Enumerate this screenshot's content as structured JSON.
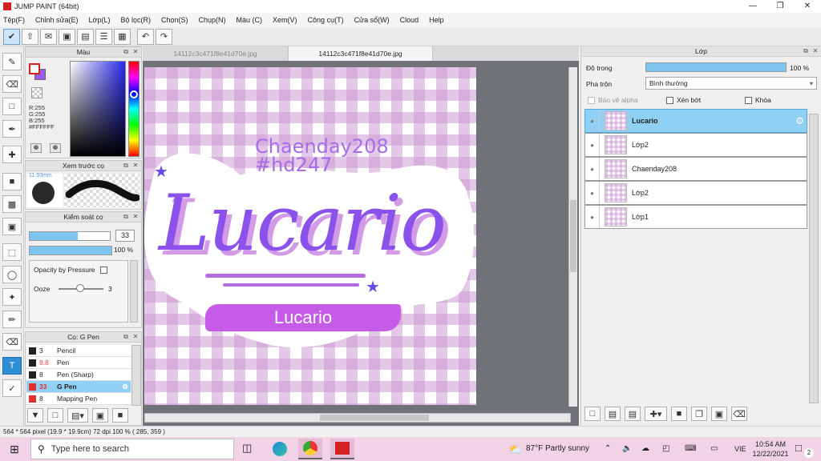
{
  "window": {
    "title": "JUMP PAINT (64bit)"
  },
  "menu": [
    "Tệp(F)",
    "Chỉnh sửa(E)",
    "Lớp(L)",
    "Bộ lọc(R)",
    "Chọn(S)",
    "Chụp(N)",
    "Màu (C)",
    "Xem(V)",
    "Công cụ(T)",
    "Cửa sổ(W)",
    "Cloud",
    "Help"
  ],
  "color_panel": {
    "title": "Màu",
    "r": "R:255",
    "g": "G:255",
    "b": "B:255",
    "hex": "#FFFFFF",
    "primary": "#ffffff",
    "secondary": "#9a5ce8"
  },
  "brush_preview": {
    "title": "Xem trước cọ",
    "size": "11.93mm"
  },
  "brush_control": {
    "title": "Kiểm soát cọ",
    "size_value": "33",
    "opacity_value": "100 %",
    "opacity_pressure": "Opacity by Pressure",
    "ooze_label": "Ooze",
    "ooze_value": "3"
  },
  "brush_list": {
    "title": "Cọ: G Pen",
    "items": [
      {
        "size": "3",
        "name": "Pencil",
        "color": "#222222",
        "size_color": "#222222"
      },
      {
        "size": "8.8",
        "name": "Pen",
        "color": "#222222",
        "size_color": "#e04040"
      },
      {
        "size": "8",
        "name": "Pen (Sharp)",
        "color": "#222222",
        "size_color": "#222222"
      },
      {
        "size": "33",
        "name": "G Pen",
        "color": "#e03030",
        "size_color": "#e03030"
      },
      {
        "size": "8",
        "name": "Mapping Pen",
        "color": "#e03030",
        "size_color": "#222222"
      }
    ]
  },
  "tabs": [
    "14112c3c471f8e41d70e.jpg",
    "14112c3c471f8e41d70e.jpg"
  ],
  "artwork": {
    "top_line1": "Chaenday208",
    "top_line2": "#hd247",
    "main": "Lucario",
    "banner": "Lucario"
  },
  "layers_panel": {
    "title": "Lớp",
    "opacity_label": "Độ trong",
    "opacity_value": "100 %",
    "blend_label": "Pha trộn",
    "blend_value": "Bình thường",
    "protect_alpha": "Bảo vệ alpha",
    "clip": "Xén bớt",
    "lock": "Khóa",
    "layers": [
      "Lucario",
      "Lớp2",
      "Chaenday208",
      "Lớp2",
      "Lớp1"
    ]
  },
  "status": {
    "text": "564 * 564 pixel   (19.9 * 19.9cm)   72 dpi   100 %   ( 285, 359 )"
  },
  "taskbar": {
    "search_placeholder": "Type here to search",
    "weather": "87°F  Partly sunny",
    "lang": "VIE",
    "time": "10:54 AM",
    "date": "12/22/2021",
    "notifications": "2"
  }
}
